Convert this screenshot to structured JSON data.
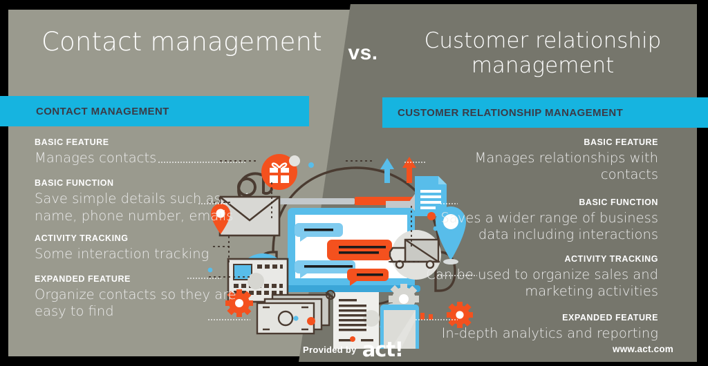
{
  "colors": {
    "left_panel_bg": "#9a9a8e",
    "right_panel_bg": "#76766c",
    "accent_blue": "#16b4e0",
    "accent_orange": "#f4511e",
    "bar_text": "#3b3b47",
    "text_white": "#ffffff"
  },
  "headings": {
    "left_title": "Contact management",
    "vs": "vs.",
    "right_title": "Customer relationship management"
  },
  "bars": {
    "left_label": "CONTACT MANAGEMENT",
    "right_label": "CUSTOMER RELATIONSHIP MANAGEMENT"
  },
  "left_column": [
    {
      "kicker": "BASIC FEATURE",
      "body": "Manages contacts"
    },
    {
      "kicker": "BASIC FUNCTION",
      "body": "Save simple details such as name, phone number, emails"
    },
    {
      "kicker": "ACTIVITY TRACKING",
      "body": "Some interaction tracking"
    },
    {
      "kicker": "EXPANDED FEATURE",
      "body": "Organize contacts so they are easy to find"
    }
  ],
  "right_column": [
    {
      "kicker": "BASIC FEATURE",
      "body": "Manages relationships with contacts"
    },
    {
      "kicker": "BASIC FUNCTION",
      "body": "Saves a wider range of business data including interactions"
    },
    {
      "kicker": "ACTIVITY TRACKING",
      "body": "Can be used to organize sales and marketing activities"
    },
    {
      "kicker": "EXPANDED FEATURE",
      "body": "In-depth analytics and reporting"
    }
  ],
  "footer": {
    "provided_by": "Provided by",
    "logo_text": "act!",
    "website": "www.act.com"
  },
  "illustration": {
    "icons": [
      "at-sign-icon",
      "envelope-icon",
      "gift-icon",
      "map-pin-orange-icon",
      "map-pin-blue-icon",
      "calculator-icon",
      "gear-orange-icon",
      "gear-gray-icon",
      "banknotes-icon",
      "document-icon",
      "laptop-chat-icon",
      "wrench-icon",
      "arrow-up-icon",
      "arrow-down-icon",
      "truck-icon",
      "file-blue-icon",
      "smartphone-icon",
      "invoice-icon",
      "wifi-signal-icon",
      "bar-chart-icon"
    ]
  }
}
